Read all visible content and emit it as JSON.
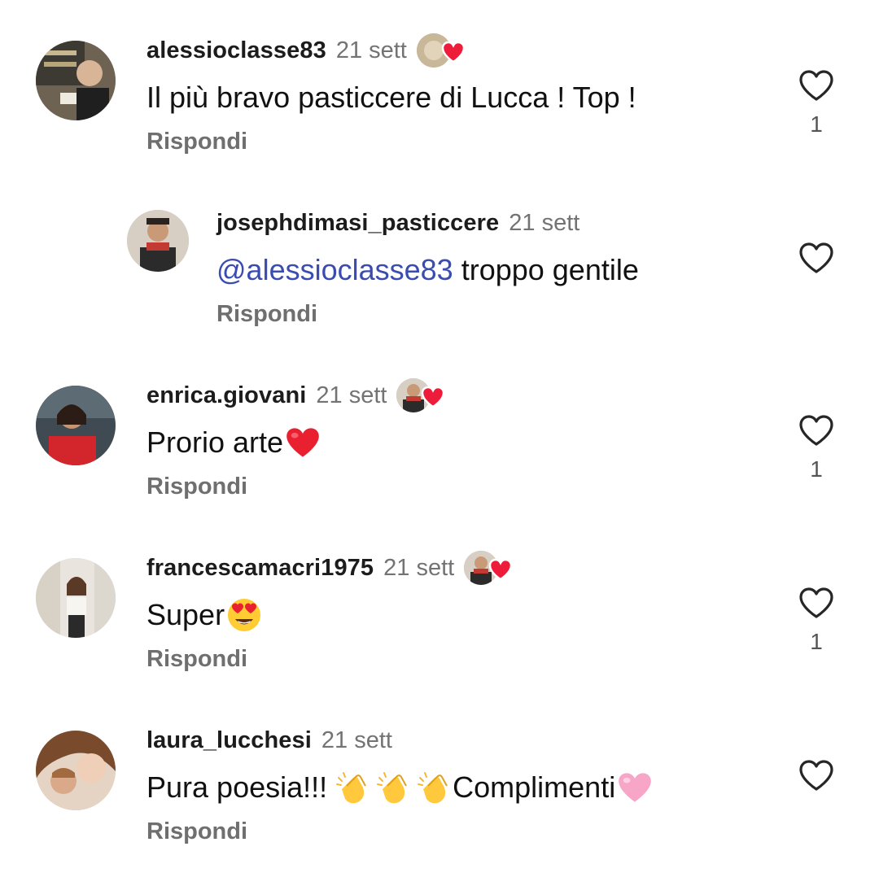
{
  "reply_label": "Rispondi",
  "colors": {
    "text": "#111111",
    "secondary": "#737373",
    "mention": "#3a4cb0",
    "heart_red": "#ed1c3a",
    "heart_pink": "#f7a6c8",
    "like_outline": "#262626"
  },
  "comments": [
    {
      "username": "alessioclasse83",
      "time": "21 sett",
      "liked_by_author": true,
      "text": "Il più bravo pasticcere di Lucca ! Top !",
      "like_count": "1",
      "icons": [
        "avatar",
        "author-liked-heart-icon",
        "like-heart-outline-icon"
      ]
    },
    {
      "username": "josephdimasi_pasticcere",
      "time": "21 sett",
      "liked_by_author": false,
      "mention": "@alessioclasse83",
      "text": " troppo gentile",
      "like_count": "",
      "icons": [
        "avatar",
        "like-heart-outline-icon"
      ]
    },
    {
      "username": "enrica.giovani",
      "time": "21 sett",
      "liked_by_author": true,
      "text": "Prorio arte",
      "emoji": "red-heart",
      "like_count": "1",
      "icons": [
        "avatar",
        "author-liked-heart-icon",
        "like-heart-outline-icon"
      ]
    },
    {
      "username": "francescamacri1975",
      "time": "21 sett",
      "liked_by_author": true,
      "text": "Super",
      "emoji": "heart-eyes",
      "like_count": "1",
      "icons": [
        "avatar",
        "author-liked-heart-icon",
        "like-heart-outline-icon"
      ]
    },
    {
      "username": "laura_lucchesi",
      "time": "21 sett",
      "liked_by_author": false,
      "text_before": "Pura poesia!!! ",
      "text": "Complimenti",
      "emoji": "pink-heart",
      "clap_count": 3,
      "like_count": "",
      "icons": [
        "avatar",
        "clapping-hands-emoji",
        "like-heart-outline-icon"
      ]
    }
  ]
}
